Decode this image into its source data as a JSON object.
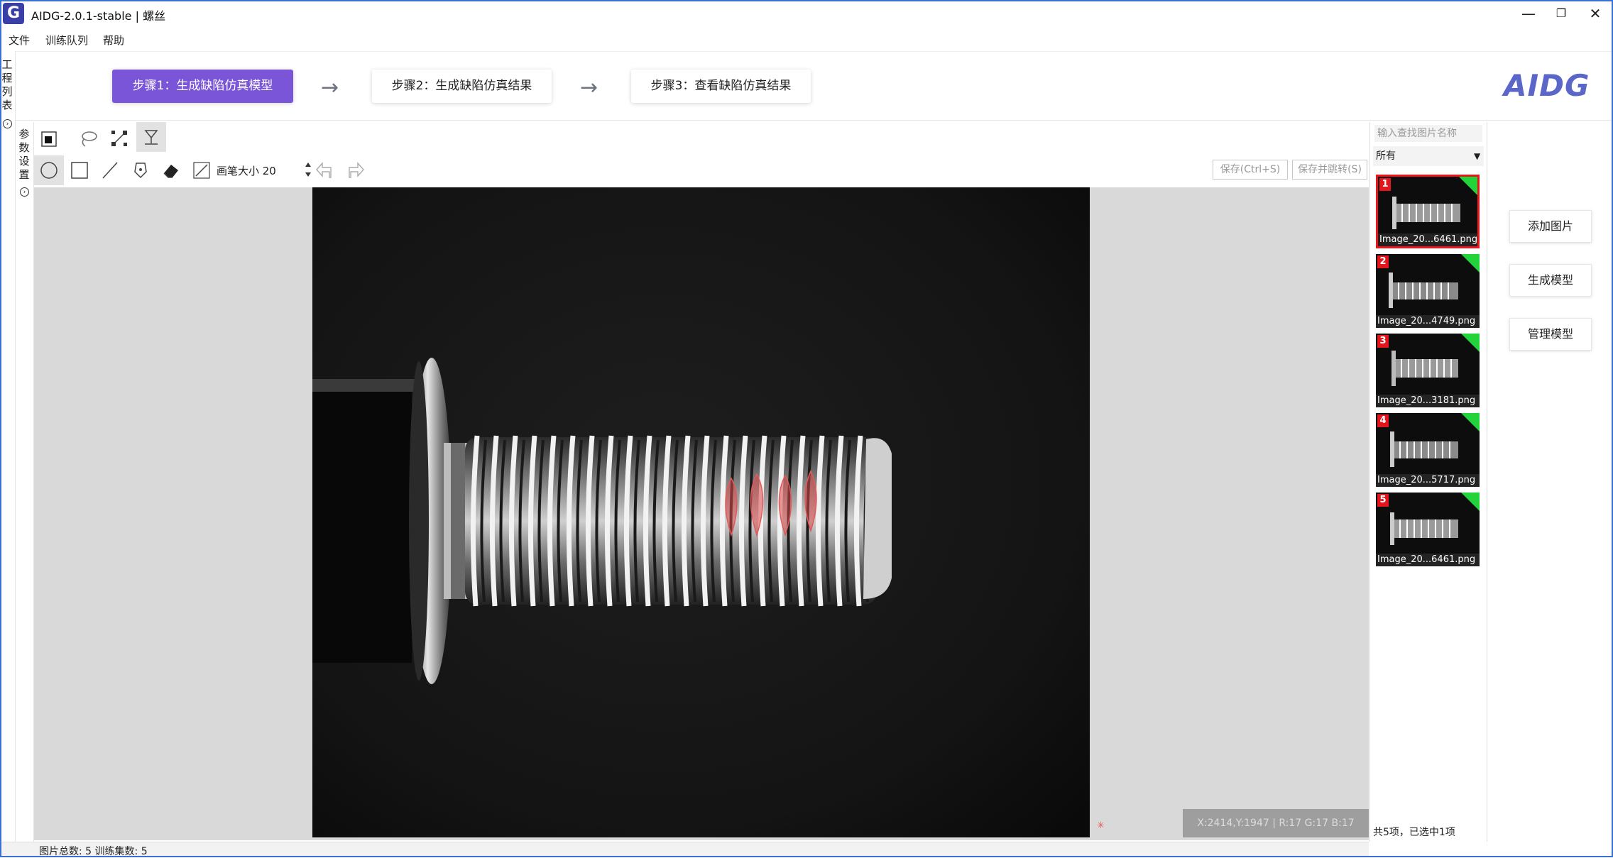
{
  "window": {
    "title": "AIDG-2.0.1-stable | 螺丝",
    "logo_letter": "G",
    "minimize": "—",
    "restore": "❐",
    "close": "✕"
  },
  "menu": [
    "文件",
    "训练队列",
    "帮助"
  ],
  "steps": [
    {
      "label": "步骤1：生成缺陷仿真模型",
      "active": true
    },
    {
      "label": "步骤2：生成缺陷仿真结果",
      "active": false
    },
    {
      "label": "步骤3：查看缺陷仿真结果",
      "active": false
    }
  ],
  "arrow_glyph": "→",
  "brand_logo": "AIDG",
  "left_panels": {
    "project_list": [
      "工",
      "程",
      "列",
      "表"
    ],
    "params": [
      "参",
      "数",
      "设",
      "置"
    ],
    "expand_glyph": "›"
  },
  "toolbar": {
    "brush_size_label": "画笔大小 20",
    "save_label": "保存(Ctrl+S)",
    "save_jump_label": "保存并跳转(S)"
  },
  "coordinate_readout": "X:2414,Y:1947 | R:17 G:17 B:17",
  "statusbar": {
    "image_count": "图片总数:   5    训练集数:   5"
  },
  "image_list": {
    "search_placeholder": "输入查找图片名称",
    "filter": "所有",
    "items": [
      {
        "num": "1",
        "name": "Image_20...6461.png",
        "selected": true
      },
      {
        "num": "2",
        "name": "Image_20...4749.png",
        "selected": false
      },
      {
        "num": "3",
        "name": "Image_20...3181.png",
        "selected": false
      },
      {
        "num": "4",
        "name": "Image_20...5717.png",
        "selected": false
      },
      {
        "num": "5",
        "name": "Image_20...6461.png",
        "selected": false
      }
    ],
    "count_text": "共5项，已选中1项"
  },
  "actions": [
    "添加图片",
    "生成模型",
    "管理模型"
  ],
  "colors": {
    "accent": "#7a55d8",
    "mask": "#d94a4a",
    "badge": "#e3161c",
    "tag": "#22d43a"
  }
}
